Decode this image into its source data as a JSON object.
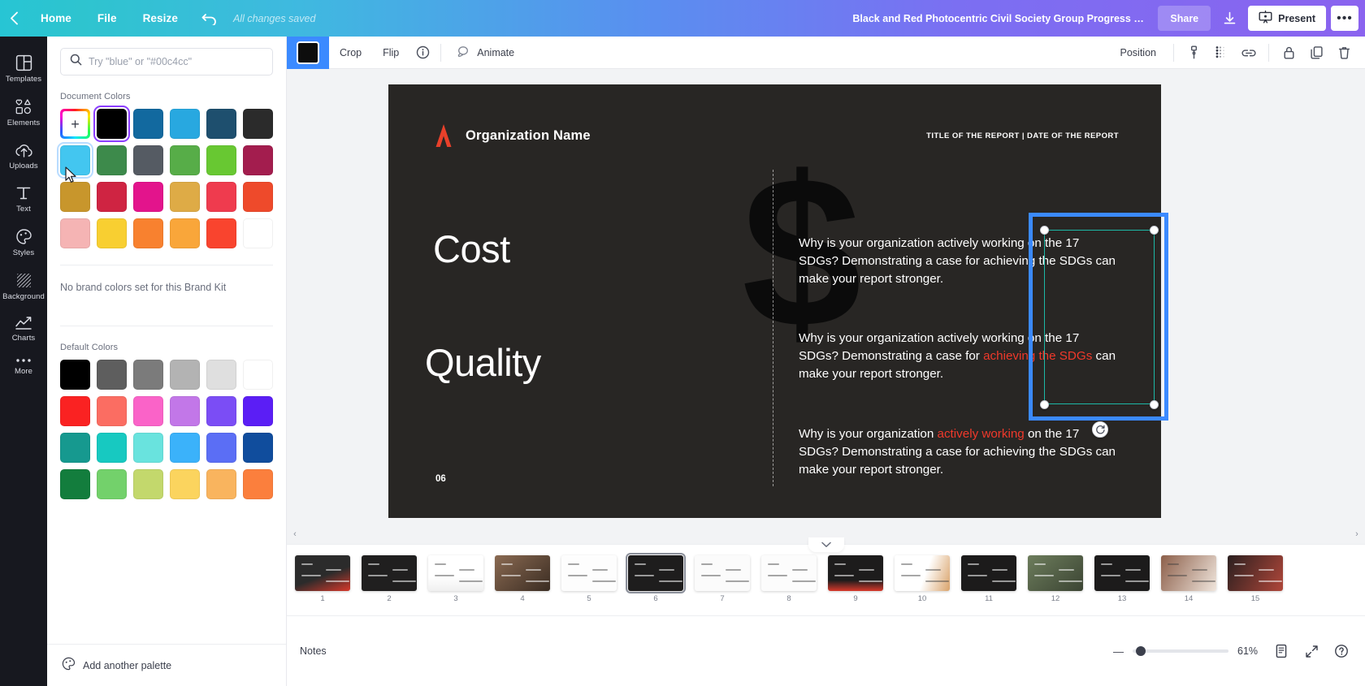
{
  "header": {
    "back_icon": "chevron-left-icon",
    "home_label": "Home",
    "file_label": "File",
    "resize_label": "Resize",
    "undo_icon": "undo-icon",
    "save_status": "All changes saved",
    "doc_title": "Black and Red Photocentric Civil Society Group Progress Re...",
    "share_label": "Share",
    "download_icon": "download-icon",
    "present_label": "Present",
    "present_icon": "present-icon",
    "more_label": "•••",
    "gradient_start": "#27c5d4",
    "gradient_end": "#8a63ef"
  },
  "rail": {
    "items": [
      {
        "label": "Templates",
        "icon": "templates-icon"
      },
      {
        "label": "Elements",
        "icon": "elements-icon"
      },
      {
        "label": "Uploads",
        "icon": "uploads-icon"
      },
      {
        "label": "Text",
        "icon": "text-icon"
      },
      {
        "label": "Styles",
        "icon": "styles-icon"
      },
      {
        "label": "Background",
        "icon": "background-icon"
      },
      {
        "label": "Charts",
        "icon": "charts-icon"
      },
      {
        "label": "More",
        "icon": "more-icon"
      }
    ]
  },
  "panel": {
    "search_placeholder": "Try \"blue\" or \"#00c4cc\"",
    "search_value": "",
    "search_icon": "search-icon",
    "document_colors_label": "Document Colors",
    "add_color_label": "+",
    "document_colors": [
      "#000000",
      "#12699f",
      "#28a8e0",
      "#1e4f6e",
      "#2b2b2b",
      "#43c6f0",
      "#3d8a4b",
      "#555b63",
      "#57ad48",
      "#68c832",
      "#a31d4e",
      "#c8962c",
      "#cf2442",
      "#e3148c",
      "#deab46",
      "#ef3b4e",
      "#ee4a2b",
      "#f5b4b4",
      "#f8cf31",
      "#f8812f",
      "#f9a63a",
      "#f9442e",
      "#ffffff"
    ],
    "document_selected_index": 0,
    "document_hovered_index": 5,
    "no_brand_colors": "No brand colors set for this Brand Kit",
    "default_colors_label": "Default Colors",
    "default_colors": [
      "#000000",
      "#5e5e5e",
      "#7b7b7b",
      "#b3b3b3",
      "#dfdfdf",
      "#ffffff",
      "#fa2222",
      "#fb6d62",
      "#fa63c8",
      "#c277e8",
      "#7b4df5",
      "#5b1ef5",
      "#16998f",
      "#17c9c1",
      "#69e3de",
      "#3bb2fa",
      "#5b6ef5",
      "#104d9d",
      "#137d3d",
      "#73d16b",
      "#c3d86c",
      "#fbd45e",
      "#f9b45e",
      "#fb7f3d"
    ],
    "add_palette_label": "Add another palette",
    "add_palette_icon": "palette-icon"
  },
  "toolbar": {
    "color_chip": "#0d0d0d",
    "crop_label": "Crop",
    "flip_label": "Flip",
    "info_icon": "info-icon",
    "animate_label": "Animate",
    "animate_icon": "animate-icon",
    "position_label": "Position",
    "transparency_icon": "transparency-icon",
    "effects_icon": "effects-icon",
    "link_icon": "link-icon",
    "lock_icon": "lock-icon",
    "duplicate_icon": "duplicate-icon",
    "delete_icon": "trash-icon"
  },
  "slide": {
    "org_name": "Organization Name",
    "report_meta": "TITLE OF THE REPORT | DATE OF THE REPORT",
    "word_one": "Cost",
    "word_two": "Quality",
    "page_number": "06",
    "dollar_glyph": "$",
    "paragraphs": [
      {
        "parts": [
          {
            "text": "Why is your organization actively working on the 17 SDGs? Demonstrating a case for achieving the SDGs can make your report stronger.",
            "highlight": false
          }
        ]
      },
      {
        "parts": [
          {
            "text": "Why is your organization actively working on the 17 SDGs? Demonstrating a case for ",
            "highlight": false
          },
          {
            "text": "achieving the SDGs",
            "highlight": true
          },
          {
            "text": " can make your report stronger.",
            "highlight": false
          }
        ]
      },
      {
        "parts": [
          {
            "text": "Why is your organization ",
            "highlight": false
          },
          {
            "text": "actively working",
            "highlight": true
          },
          {
            "text": " on the 17 SDGs? Demonstrating a case for achieving the SDGs can make your report stronger.",
            "highlight": false
          }
        ]
      }
    ],
    "selection_color": "#3b8aff",
    "inner_frame_color": "#1db8a6",
    "highlight_color": "#f0392b",
    "background_color": "#282624"
  },
  "strip": {
    "collapse_icon": "chevron-down-icon",
    "active_page": 6,
    "pages": [
      {
        "num": "1"
      },
      {
        "num": "2"
      },
      {
        "num": "3"
      },
      {
        "num": "4"
      },
      {
        "num": "5"
      },
      {
        "num": "6"
      },
      {
        "num": "7"
      },
      {
        "num": "8"
      },
      {
        "num": "9"
      },
      {
        "num": "10"
      },
      {
        "num": "11"
      },
      {
        "num": "12"
      },
      {
        "num": "13"
      },
      {
        "num": "14"
      },
      {
        "num": "15"
      }
    ]
  },
  "bottom": {
    "notes_label": "Notes",
    "zoom_minus": "—",
    "zoom_percent": "61%",
    "pages_view_icon": "pages-view-icon",
    "fullscreen_icon": "fullscreen-icon",
    "help_icon": "help-icon"
  }
}
